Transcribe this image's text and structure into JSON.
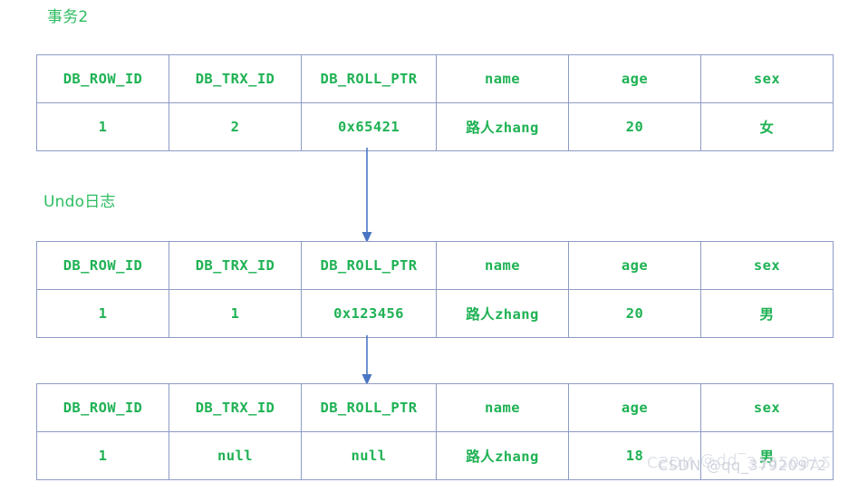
{
  "captions": {
    "transaction": "事务2",
    "undo_log": "Undo日志"
  },
  "columns": [
    "DB_ROW_ID",
    "DB_TRX_ID",
    "DB_ROLL_PTR",
    "name",
    "age",
    "sex"
  ],
  "tables": [
    {
      "id": "current-record",
      "headers": [
        "DB_ROW_ID",
        "DB_TRX_ID",
        "DB_ROLL_PTR",
        "name",
        "age",
        "sex"
      ],
      "row": {
        "DB_ROW_ID": "1",
        "DB_TRX_ID": "2",
        "DB_ROLL_PTR": "0x65421",
        "name": "路人zhang",
        "age": "20",
        "sex": "女"
      }
    },
    {
      "id": "undo-version-1",
      "headers": [
        "DB_ROW_ID",
        "DB_TRX_ID",
        "DB_ROLL_PTR",
        "name",
        "age",
        "sex"
      ],
      "row": {
        "DB_ROW_ID": "1",
        "DB_TRX_ID": "1",
        "DB_ROLL_PTR": "0x123456",
        "name": "路人zhang",
        "age": "20",
        "sex": "男"
      }
    },
    {
      "id": "undo-version-2",
      "headers": [
        "DB_ROW_ID",
        "DB_TRX_ID",
        "DB_ROLL_PTR",
        "name",
        "age",
        "sex"
      ],
      "row": {
        "DB_ROW_ID": "1",
        "DB_TRX_ID": "null",
        "DB_ROLL_PTR": "null",
        "name": "路人zhang",
        "age": "18",
        "sex": "男"
      }
    }
  ],
  "arrows": [
    {
      "id": "rollptr-link-1",
      "from": "current-record.DB_ROLL_PTR",
      "to": "undo-version-1"
    },
    {
      "id": "rollptr-link-2",
      "from": "undo-version-1.DB_ROLL_PTR",
      "to": "undo-version-2"
    }
  ],
  "watermark": {
    "main": "CSDN @qq_37920972",
    "sub": "CSDN @qq_37920972"
  },
  "colors": {
    "text_green": "#1fb254",
    "caption_green": "#2dbc61",
    "border_blue": "#8d9cc6",
    "arrow_blue": "#4a76c4",
    "background": "#ffffff",
    "watermark_gray": "#c8cdd8"
  }
}
